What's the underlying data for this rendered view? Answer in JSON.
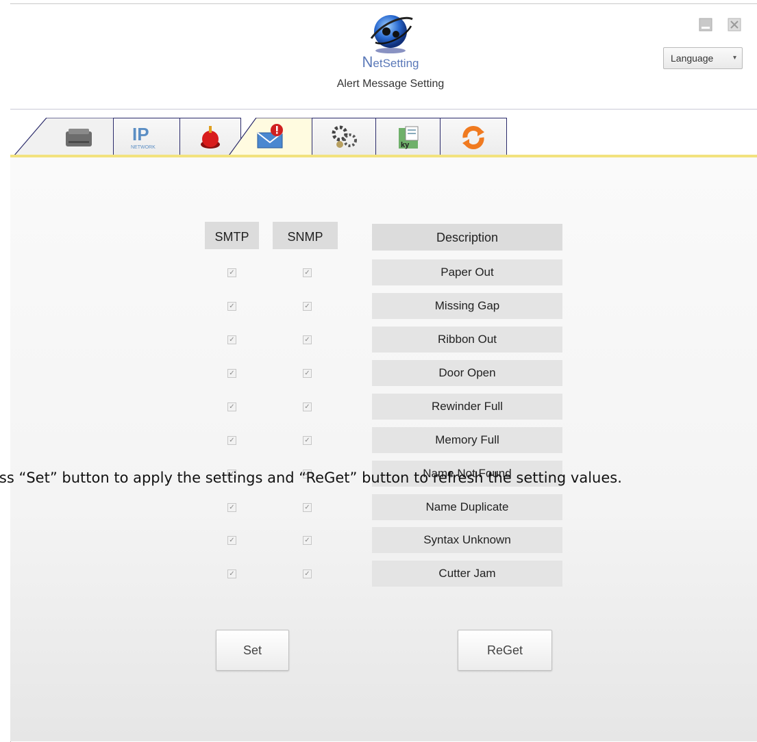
{
  "app": {
    "logo_text_cap": "N",
    "logo_text_rest": "etSetting",
    "subtitle": "Alert Message Setting"
  },
  "window_controls": [
    "minimize-icon",
    "close-icon"
  ],
  "language": {
    "label": "Language"
  },
  "tabs": [
    {
      "icon": "printer-icon"
    },
    {
      "icon": "ip-network-icon",
      "text": "IP",
      "subtext": "NETWORK"
    },
    {
      "icon": "alarm-button-icon"
    },
    {
      "icon": "alert-mail-icon",
      "active": true
    },
    {
      "icon": "gears-icon"
    },
    {
      "icon": "key-file-icon"
    },
    {
      "icon": "refresh-icon"
    }
  ],
  "table": {
    "headers": {
      "smtp": "SMTP",
      "snmp": "SNMP",
      "description": "Description"
    },
    "rows": [
      {
        "label": "Paper Out",
        "smtp": true,
        "snmp": true
      },
      {
        "label": "Missing Gap",
        "smtp": true,
        "snmp": true
      },
      {
        "label": "Ribbon Out",
        "smtp": true,
        "snmp": true
      },
      {
        "label": "Door Open",
        "smtp": true,
        "snmp": true
      },
      {
        "label": "Rewinder Full",
        "smtp": true,
        "snmp": true
      },
      {
        "label": "Memory Full",
        "smtp": true,
        "snmp": true
      },
      {
        "label": "Name Not Found",
        "smtp": true,
        "snmp": true
      },
      {
        "label": "Name Duplicate",
        "smtp": true,
        "snmp": true
      },
      {
        "label": "Syntax Unknown",
        "smtp": true,
        "snmp": true
      },
      {
        "label": "Cutter Jam",
        "smtp": true,
        "snmp": true
      }
    ]
  },
  "buttons": {
    "set": "Set",
    "reget": "ReGet"
  },
  "overlay_text": "ess “Set” button to apply the settings and “ReGet” button to refresh the setting values."
}
